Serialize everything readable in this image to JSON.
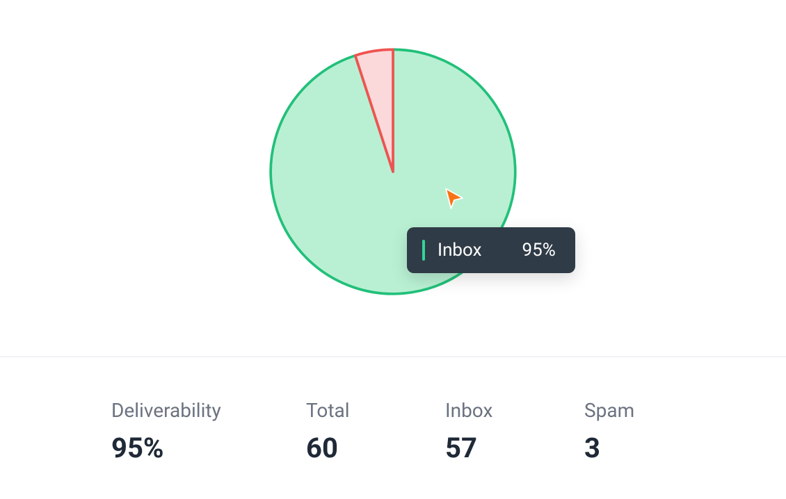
{
  "chart_data": {
    "type": "pie",
    "series": [
      {
        "name": "Inbox",
        "value": 57,
        "percent": 95,
        "color": "#b9f0d3",
        "stroke": "#22c07a"
      },
      {
        "name": "Spam",
        "value": 3,
        "percent": 5,
        "color": "#fbd9db",
        "stroke": "#ef5350"
      }
    ],
    "title": ""
  },
  "tooltip": {
    "label": "Inbox",
    "value": "95%"
  },
  "stats": {
    "deliverability": {
      "label": "Deliverability",
      "value": "95%"
    },
    "total": {
      "label": "Total",
      "value": "60"
    },
    "inbox": {
      "label": "Inbox",
      "value": "57"
    },
    "spam": {
      "label": "Spam",
      "value": "3"
    }
  }
}
